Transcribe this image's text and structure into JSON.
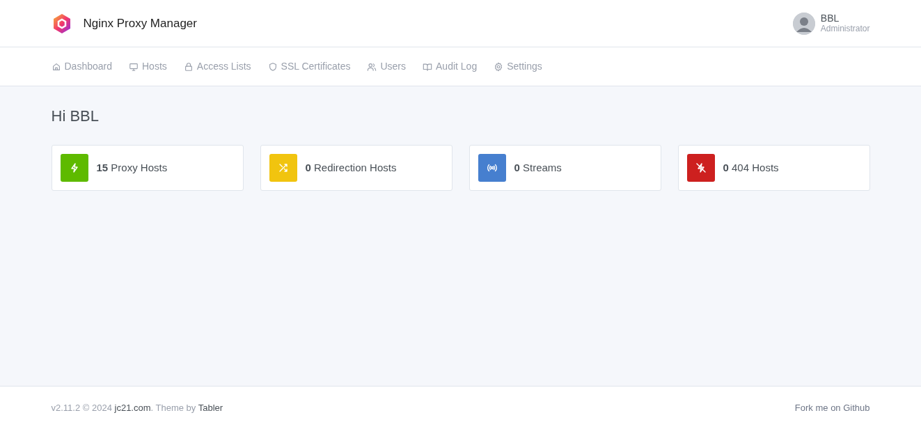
{
  "header": {
    "title": "Nginx Proxy Manager",
    "user": {
      "name": "BBL",
      "role": "Administrator"
    }
  },
  "nav": [
    {
      "label": "Dashboard",
      "kind": "home"
    },
    {
      "label": "Hosts",
      "kind": "monitor"
    },
    {
      "label": "Access Lists",
      "kind": "lock"
    },
    {
      "label": "SSL Certificates",
      "kind": "shield"
    },
    {
      "label": "Users",
      "kind": "users"
    },
    {
      "label": "Audit Log",
      "kind": "book"
    },
    {
      "label": "Settings",
      "kind": "gear"
    }
  ],
  "greeting": "Hi BBL",
  "stats": [
    {
      "count": "15",
      "label": "Proxy Hosts",
      "kind": "zap",
      "color": "#5eba00"
    },
    {
      "count": "0",
      "label": "Redirection Hosts",
      "kind": "shuffle",
      "color": "#f1c40f"
    },
    {
      "count": "0",
      "label": "Streams",
      "kind": "radio",
      "color": "#467fcf"
    },
    {
      "count": "0",
      "label": "404 Hosts",
      "kind": "zapoff",
      "color": "#cd201f"
    }
  ],
  "footer": {
    "version": "v2.11.2 © 2024",
    "site_link": "jc21.com",
    "theme_text": ". Theme by",
    "theme_link": "Tabler",
    "github_link": "Fork me on Github"
  }
}
